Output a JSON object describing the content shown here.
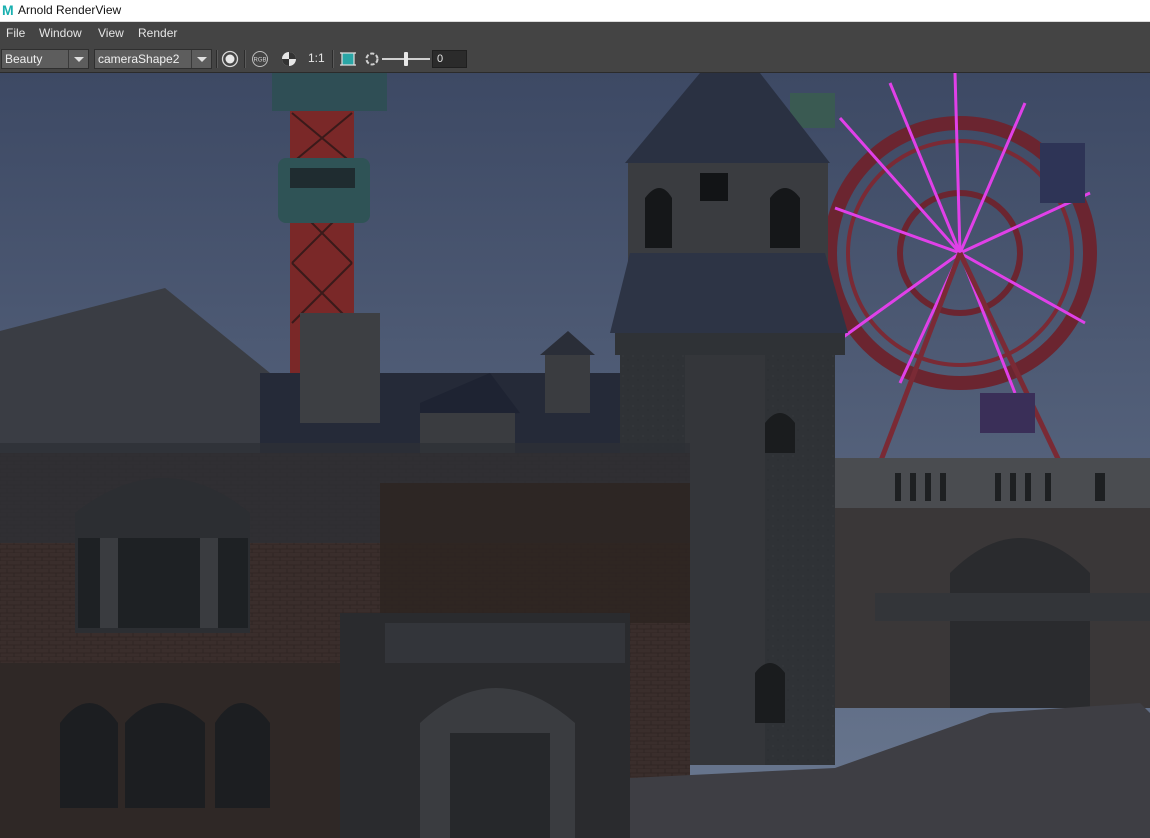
{
  "window": {
    "title": "Arnold RenderView",
    "app_icon": "maya-m-icon"
  },
  "menubar": {
    "items": [
      "File",
      "Window",
      "View",
      "Render"
    ]
  },
  "toolbar": {
    "aov_value": "Beauty",
    "camera_value": "cameraShape2",
    "ratio_label": "1:1",
    "exposure_value": "0",
    "icons": [
      "render-sphere-icon",
      "rgb-channels-icon",
      "display-lut-icon",
      "crop-region-icon",
      "refresh-icon",
      "exposure-slider"
    ]
  },
  "viewport": {
    "content": "render-image",
    "palette": {
      "sky": "#4a5670",
      "ferris_spokes": "#e040e8",
      "ferris_frame": "#7a2a35",
      "tower_red": "#8b2a2a",
      "ground": "#3e3e44"
    }
  }
}
